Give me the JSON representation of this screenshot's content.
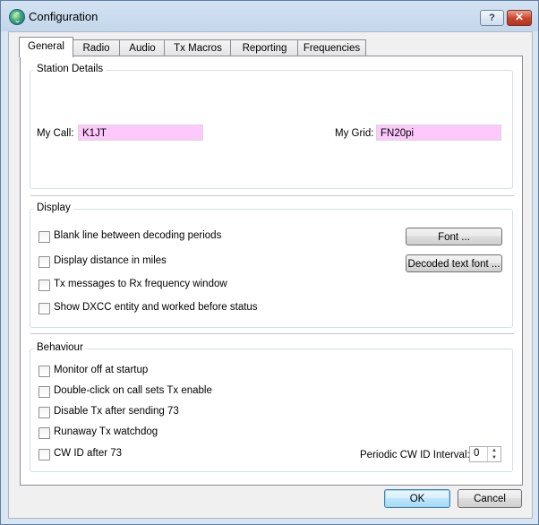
{
  "window": {
    "title": "Configuration",
    "help_glyph": "?",
    "close_glyph": "✕",
    "icon": "globe-icon"
  },
  "tabs": [
    {
      "label": "General",
      "active": true
    },
    {
      "label": "Radio",
      "active": false
    },
    {
      "label": "Audio",
      "active": false
    },
    {
      "label": "Tx Macros",
      "active": false
    },
    {
      "label": "Reporting",
      "active": false
    },
    {
      "label": "Frequencies",
      "active": false
    }
  ],
  "station": {
    "group_title": "Station Details",
    "my_call_label": "My Call:",
    "my_call_value": "K1JT",
    "my_grid_label": "My Grid:",
    "my_grid_value": "FN20pi",
    "field_color": "#fdc8fc"
  },
  "display": {
    "group_title": "Display",
    "options": [
      {
        "label": "Blank line between decoding periods",
        "checked": false
      },
      {
        "label": "Display distance in miles",
        "checked": false
      },
      {
        "label": "Tx messages to Rx frequency window",
        "checked": false
      },
      {
        "label": "Show DXCC entity and worked before status",
        "checked": false
      }
    ],
    "font_button": "Font ...",
    "decoded_font_button": "Decoded text font ..."
  },
  "behaviour": {
    "group_title": "Behaviour",
    "options": [
      {
        "label": "Monitor off at startup",
        "checked": false
      },
      {
        "label": "Double-click on call sets Tx enable",
        "checked": false
      },
      {
        "label": "Disable Tx after sending 73",
        "checked": false
      },
      {
        "label": "Runaway Tx watchdog",
        "checked": false
      },
      {
        "label": "CW ID after 73",
        "checked": false
      }
    ],
    "cw_interval_label": "Periodic CW ID Interval:",
    "cw_interval_value": "0",
    "spin_up_glyph": "▲",
    "spin_down_glyph": "▼"
  },
  "footer": {
    "ok_label": "OK",
    "cancel_label": "Cancel"
  }
}
